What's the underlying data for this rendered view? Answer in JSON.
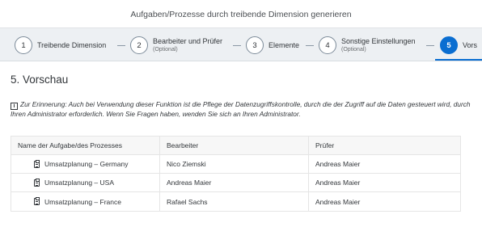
{
  "dialog": {
    "title": "Aufgaben/Prozesse durch treibende Dimension generieren"
  },
  "wizard": {
    "steps": [
      {
        "number": "1",
        "label": "Treibende Dimension",
        "sublabel": ""
      },
      {
        "number": "2",
        "label": "Bearbeiter und Prüfer",
        "sublabel": "(Optional)"
      },
      {
        "number": "3",
        "label": "Elemente",
        "sublabel": ""
      },
      {
        "number": "4",
        "label": "Sonstige Einstellungen",
        "sublabel": "(Optional)"
      },
      {
        "number": "5",
        "label": "Vors",
        "sublabel": ""
      }
    ],
    "active_step": 5,
    "accent_color": "#0a6ed1"
  },
  "section": {
    "title": "5. Vorschau"
  },
  "note": {
    "icon": "info-icon",
    "text": "Zur Erinnerung: Auch bei Verwendung dieser Funktion ist die Pflege der Datenzugriffskontrolle, durch die der Zugriff auf die Daten gesteuert wird, durch Ihren Administrator erforderlich. Wenn Sie Fragen haben, wenden Sie sich an Ihren Administrator."
  },
  "table": {
    "headers": [
      "Name der Aufgabe/des Prozesses",
      "Bearbeiter",
      "Prüfer"
    ],
    "rows": [
      {
        "task": "Umsatzplanung – Germany",
        "assignee": "Nico Ziemski",
        "reviewer": "Andreas Maier"
      },
      {
        "task": "Umsatzplanung – USA",
        "assignee": "Andreas Maier",
        "reviewer": "Andreas Maier"
      },
      {
        "task": "Umsatzplanung – France",
        "assignee": "Rafael Sachs",
        "reviewer": "Andreas Maier"
      }
    ],
    "row_icon": "task-clipboard-icon"
  }
}
